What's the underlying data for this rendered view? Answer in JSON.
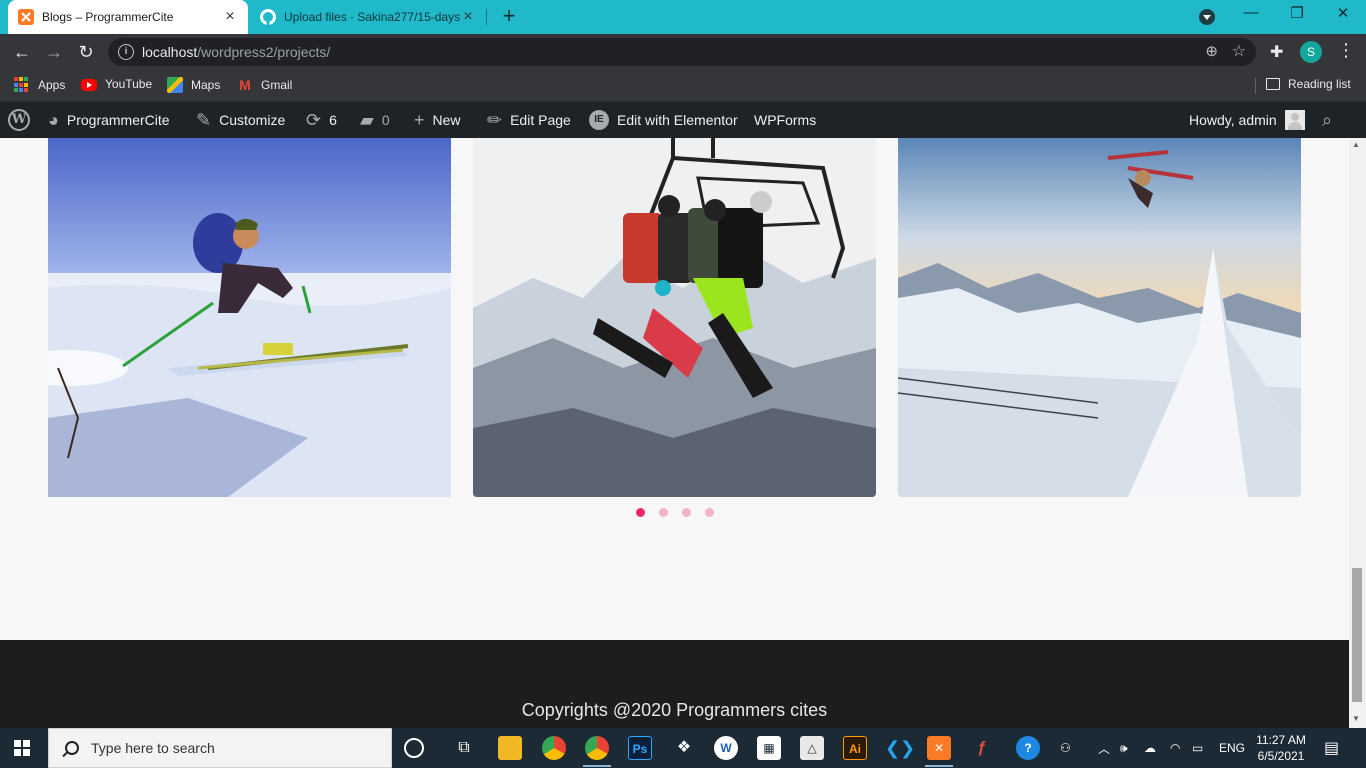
{
  "browser": {
    "tabs": [
      {
        "title": "Blogs – ProgrammerCite",
        "active": true,
        "favicon": "xampp-icon"
      },
      {
        "title": "Upload files · Sakina277/15-days",
        "active": false,
        "favicon": "github-icon"
      }
    ],
    "new_tab": "+",
    "url_host": "localhost",
    "url_path": "/wordpress2/projects/",
    "profile_initial": "S"
  },
  "bookmarks": [
    {
      "label": "Apps",
      "icon": "apps-grid-icon"
    },
    {
      "label": "YouTube",
      "icon": "youtube-icon"
    },
    {
      "label": "Maps",
      "icon": "maps-icon"
    },
    {
      "label": "Gmail",
      "icon": "gmail-icon"
    }
  ],
  "reading_list": "Reading list",
  "adminbar": {
    "site_name": "ProgrammerCite",
    "customize": "Customize",
    "updates_count": "6",
    "comments_count": "0",
    "new": "New",
    "edit_page": "Edit Page",
    "edit_elementor": "Edit with Elementor",
    "wpforms": "WPForms",
    "howdy": "Howdy, admin"
  },
  "carousel": {
    "images": [
      "skier-downhill-photo",
      "chairlift-snowboarders-photo",
      "freestyle-ski-jump-photo"
    ],
    "active_dot": 1,
    "dot_count": 4
  },
  "footer": {
    "text": "Copyrights @2020 Programmers cites"
  },
  "taskbar": {
    "search_placeholder": "Type here to search",
    "language": "ENG",
    "time": "11:27 AM",
    "date": "6/5/2021"
  },
  "colors": {
    "tab_strip": "#1fb9c9",
    "admin_bar": "#1d2327",
    "dot_active": "#ee2a63",
    "dot_inactive": "#f3b3c7",
    "footer": "#1d1d1d",
    "taskbar": "#1c2a35"
  }
}
